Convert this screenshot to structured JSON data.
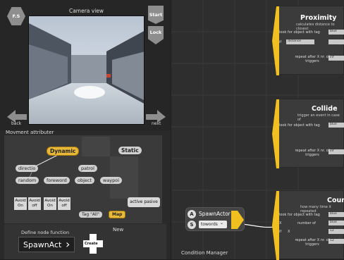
{
  "left": {
    "fs_label": "F.S",
    "camera_title": "Camera view",
    "start_label": "Start",
    "lock_label": "Lock",
    "back_label": "back",
    "next_label": "next"
  },
  "movement": {
    "title": "Movment attributer",
    "dynamic": "Dynamic",
    "static": "Static",
    "directio": "directio",
    "patrol": "patrol",
    "random": "random",
    "foreword": "foreword",
    "object": "object",
    "waypoi": "waypoi",
    "boxes": [
      {
        "a": "Avoid",
        "b": "On"
      },
      {
        "a": "Avoid",
        "b": "off"
      },
      {
        "a": "Avoid",
        "b": "On"
      },
      {
        "a": "Avoid",
        "b": "off"
      }
    ],
    "active": "active",
    "pasive": "pasive",
    "tag_all": "Tag \"All\"",
    "map": "Map"
  },
  "define": {
    "label": "Define node function",
    "function_name": "SpawnAct",
    "create": "Create",
    "new_label": "New"
  },
  "condition_manager": "Condition Manager",
  "spawn_node": {
    "a": "A",
    "s": "S",
    "title": "SpawnActor",
    "select": "towords"
  },
  "nodes": {
    "proximity": {
      "title": "Proximity",
      "sub": "calculates distance to closest",
      "row1": "look for object with tag",
      "row1_val": "blue",
      "row2_prefix": "if",
      "row2": "distance",
      "row3": "repeat after X nr. of triggers",
      "row3_val": "inf"
    },
    "collide": {
      "title": "Collide",
      "sub": "trigger an event in case of",
      "row1": "look for object with tag",
      "row1_val": "blue",
      "row2": "repeat after X nr. of triggers",
      "row2_val": "inf"
    },
    "count": {
      "title": "Count",
      "sub": "how many time it repeated",
      "row1": "look for object with tag",
      "row1_val": "blue",
      "row2_x": "X",
      "row2": "number of",
      "row2_val": "blue",
      "row3_prefix": "if",
      "row3_x": "X",
      "row3_val": "12",
      "row4": "repeat after X nr. of triggers",
      "row4_val": "12"
    }
  }
}
